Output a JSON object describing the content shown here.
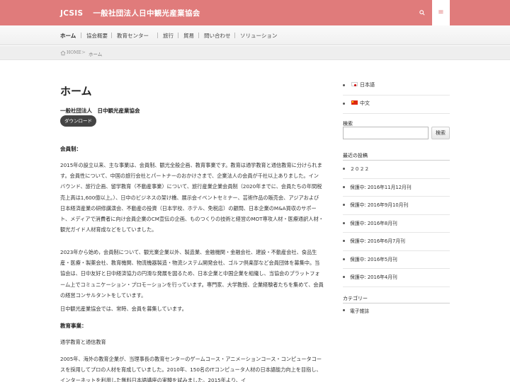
{
  "header": {
    "abbr": "JCSIS",
    "title": "一般社団法人日中観光産業協会",
    "search_icon": "search-icon",
    "menu_icon": "hamburger-icon"
  },
  "nav": {
    "items": [
      "ホーム",
      "協会概要",
      "教育センター",
      "旅行",
      "貿易",
      "問い合わせ",
      "ソリューション"
    ]
  },
  "breadcrumb": {
    "home": "HOME",
    "separator": ">",
    "current": "ホーム"
  },
  "main": {
    "title": "ホーム",
    "org_name": "一般社団法人　日中観光産業協会",
    "download_label": "ダウンロード",
    "membership_heading": "会員制：",
    "para1": "2015年の設立以来、主な事業は、会員制、観光全般企画、教育事業です。教育は通学教育と通信教育に分けられます。会員性について、中国の旅行会社とパートナーのおかけさまで、企業法人の会員が千社以上ありました。インバウンド、旅行企画、留学教育（不動産事業）について、旅行産業企業会員制（2020年までに、会員たちの年間税売上高は1,600億以上。）、日中のビジネスの架け橋、展示会イベントセミナー、芸術作品の販売会、アジアおよび日本経済産業の研修講演会、不動産の投資（日本学校、ホテル、免税店）の顧問、日本企業のM&A買収のサポート、メディアで消費者に向け会員企業のCM宣伝の企画、ものつくりの技術と経営のMOT専攻人材・医療通訳人材・観光ガイド人材育成などをしていました。",
    "para2": "2023年から始め，会員制について、観光業企業以外、製造業、金融機関・金融会社、建設・不動産会社、食品生産・医療・製薬会社、教育機関、物流機器製造・物流システム開発会社、ゴルフ倶楽部など会員団体を募集中。当協会は、日中友好と日中経済協力の円滑な発展を図るため、日本企業と中国企業を組織し、当協会のプラットフォーム上でコミュニケーション・プロモーションを行っています。専門家、大学教授、企業経験者たちを集めて、会員の経営コンサルタントをしています。",
    "para3": "日中観光産業協会では、常時、会員を募集しています。",
    "education_heading": "教育事業：",
    "para4": "通学教育と通信教育",
    "para5": "2005年、海外の教育企業が、当理事長の教育センターのゲームコース・アニメーションコース・コンピュータコースを採用してプロの人材を育成していました。2010年、150名のITコンピュータ人材の日本語能力向上を目指し、インターネットを利用した無料日本語講座の実験を試みました。2015年より、イ"
  },
  "sidebar": {
    "languages": [
      {
        "label": "日本語",
        "flag": "jp"
      },
      {
        "label": "中文",
        "flag": "cn"
      }
    ],
    "search_title": "検索",
    "search_value": "",
    "search_button": "検索",
    "recent_title": "最近の投稿",
    "recent_posts": [
      "２０２２",
      "保護中: 2016年11月12月刊",
      "保護中: 2016年9月10月刊",
      "保護中: 2016年8月刊",
      "保護中: 2016年6月7月刊",
      "保護中: 2016年5月刊",
      "保護中: 2016年4月刊"
    ],
    "category_title": "カテゴリー",
    "categories": [
      "電子雑誌"
    ]
  },
  "colors": {
    "header_bg": "#e07b7b",
    "download_bg": "#444444"
  }
}
